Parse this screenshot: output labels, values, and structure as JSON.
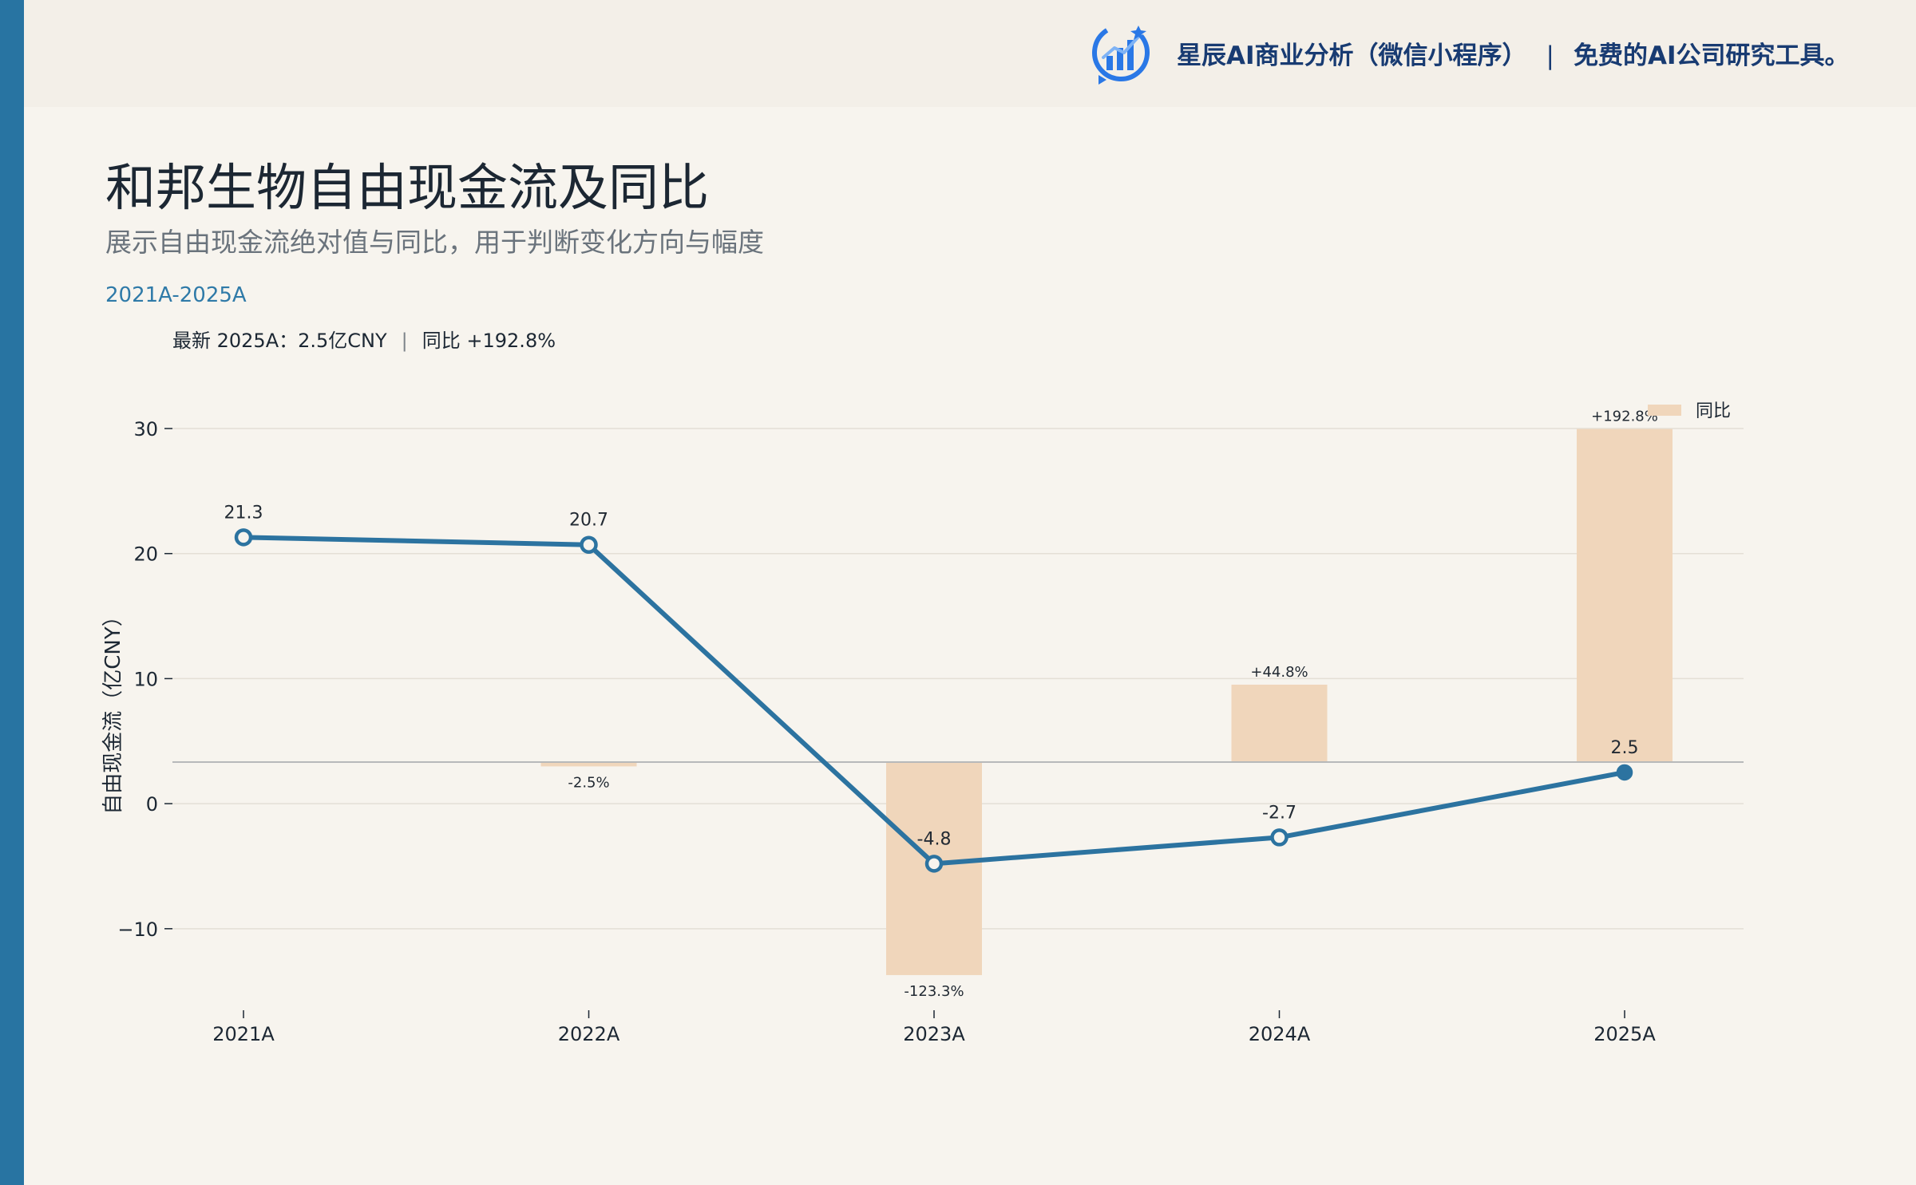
{
  "brand": {
    "logo_icon": "bar-chart-logo-icon",
    "name": "星辰AI商业分析（微信小程序）",
    "separator": "|",
    "tagline": "免费的AI公司研究工具。"
  },
  "header": {
    "title": "和邦生物自由现金流及同比",
    "subtitle": "展示自由现金流绝对值与同比，用于判断变化方向与幅度",
    "period": "2021A-2025A"
  },
  "summary": {
    "latest": "最新 2025A：2.5亿CNY",
    "separator": "|",
    "yoy": "同比 +192.8%"
  },
  "colors": {
    "accent": "#2874a2",
    "line": "#2c73a0",
    "bar": "#f0d6bb",
    "brand_text": "#183b72",
    "page_bg": "#f7f4ee"
  },
  "chart_data": {
    "type": "line",
    "categories": [
      "2021A",
      "2022A",
      "2023A",
      "2024A",
      "2025A"
    ],
    "ylabel": "自由现金流（亿CNY）",
    "ylim": [
      -15.5,
      33
    ],
    "yticks": [
      -10,
      0,
      10,
      20,
      30
    ],
    "ytick_labels": [
      "−10",
      "0",
      "10",
      "20",
      "30"
    ],
    "grid": true,
    "series": [
      {
        "type": "line",
        "values": [
          21.3,
          20.7,
          -4.8,
          -2.7,
          2.5
        ],
        "value_labels": [
          "21.3",
          "20.7",
          "-4.8",
          "-2.7",
          "2.5"
        ]
      },
      {
        "type": "bar",
        "name": "同比",
        "unit": "%",
        "values": [
          null,
          -2.5,
          -123.3,
          44.8,
          192.8
        ],
        "value_labels": [
          "",
          "-2.5%",
          "-123.3%",
          "+44.8%",
          "+192.8%"
        ],
        "secondary_axis": true,
        "secondary_ylim": [
          -100,
          200
        ]
      }
    ],
    "legend": {
      "position": "top-right",
      "label": "同比"
    }
  }
}
